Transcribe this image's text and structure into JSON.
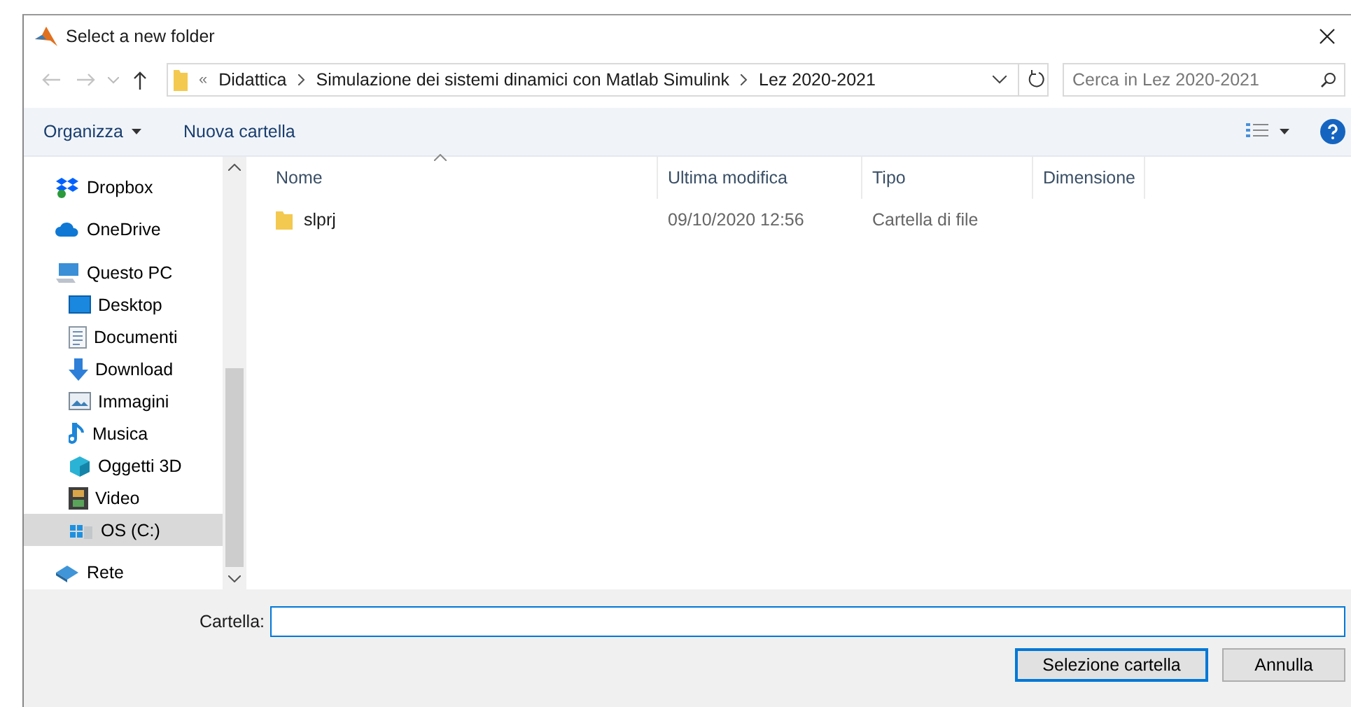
{
  "window": {
    "title": "Select a new folder"
  },
  "navigation": {
    "back_disabled": true,
    "forward_disabled": true,
    "up_disabled": false
  },
  "address": {
    "overflow": "«",
    "segments": [
      "Didattica",
      "Simulazione dei sistemi dinamici con Matlab Simulink",
      "Lez 2020-2021"
    ]
  },
  "search": {
    "placeholder": "Cerca in Lez 2020-2021"
  },
  "toolbar": {
    "buttons": [
      {
        "label": "Organizza",
        "dropdown": true
      },
      {
        "label": "Nuova cartella",
        "dropdown": false
      }
    ]
  },
  "sidebar": {
    "items": [
      {
        "label": "Dropbox",
        "selected": false
      },
      {
        "label": "OneDrive",
        "selected": false
      },
      {
        "label": "Questo PC",
        "selected": false,
        "children": [
          {
            "label": "Desktop",
            "selected": false
          },
          {
            "label": "Documenti",
            "selected": false
          },
          {
            "label": "Download",
            "selected": false
          },
          {
            "label": "Immagini",
            "selected": false
          },
          {
            "label": "Musica",
            "selected": false
          },
          {
            "label": "Oggetti 3D",
            "selected": false
          },
          {
            "label": "Video",
            "selected": false
          },
          {
            "label": "OS (C:)",
            "selected": true
          }
        ]
      },
      {
        "label": "Rete",
        "selected": false
      }
    ]
  },
  "table": {
    "columns": [
      {
        "label": "Nome",
        "sorted": true
      },
      {
        "label": "Ultima modifica",
        "sorted": false
      },
      {
        "label": "Tipo",
        "sorted": false
      },
      {
        "label": "Dimensione",
        "sorted": false
      }
    ],
    "rows": [
      {
        "cells": [
          "slprj",
          "09/10/2020 12:56",
          "Cartella di file",
          ""
        ]
      }
    ]
  },
  "folder_field": {
    "label": "Cartella:",
    "focused": true
  },
  "buttons": [
    {
      "label": "Selezione cartella",
      "default": true
    },
    {
      "label": "Annulla",
      "default": false
    }
  ]
}
